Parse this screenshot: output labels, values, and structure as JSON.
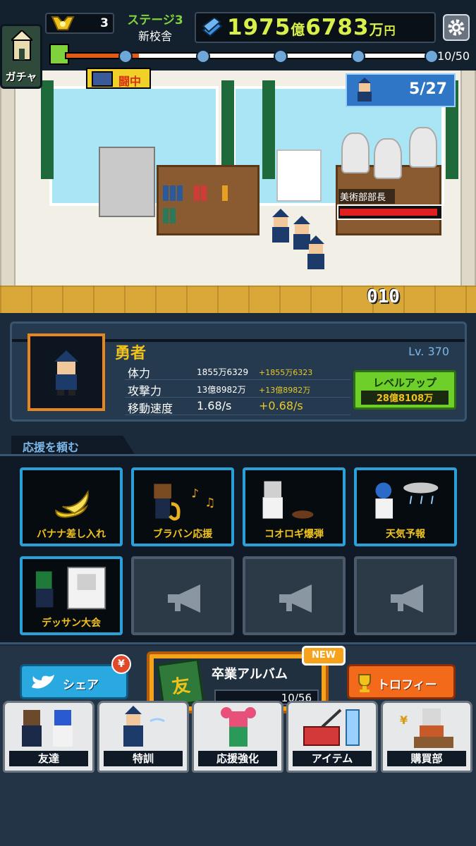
{
  "top": {
    "medal_count": "3",
    "stage_name": "ステージ3",
    "stage_place": "新校舎",
    "money_a": "1975",
    "money_unit_a": "億",
    "money_b": "6783",
    "money_unit_b": "万",
    "money_unit_c": "円",
    "progress_count": "10/50",
    "progress_fraction": 0.2,
    "gacha_label": "ガチャ",
    "fight_label": "闘中"
  },
  "battle": {
    "wave_count": "5/27",
    "boss_name": "美術部部長",
    "boss_hp_fraction": 0.97,
    "damage_number": "010"
  },
  "hero": {
    "name": "勇者",
    "level": "Lv. 370",
    "stats": [
      {
        "label": "体力",
        "value": "1855万6329",
        "bonus": "+1855万6323",
        "size": "small"
      },
      {
        "label": "攻撃力",
        "value": "13億8982万",
        "bonus": "+13億8982万",
        "size": "small"
      },
      {
        "label": "移動速度",
        "value": "1.68/s",
        "bonus": "+0.68/s",
        "size": "big"
      }
    ],
    "levelup_label": "レベルアップ",
    "levelup_cost": "28億8108万"
  },
  "support": {
    "tab_label": "応援を頼む",
    "cards": [
      {
        "name": "バナナ差し入れ",
        "icon": "banana-icon"
      },
      {
        "name": "ブラバン応援",
        "icon": "saxophone-icon"
      },
      {
        "name": "コオロギ爆弾",
        "icon": "cricket-icon"
      },
      {
        "name": "天気予報",
        "icon": "weather-icon"
      },
      {
        "name": "デッサン大会",
        "icon": "sketch-icon"
      }
    ]
  },
  "bottom": {
    "share_label": "シェア",
    "yen_badge": "¥",
    "album_title": "卒業アルバム",
    "album_count": "10/56",
    "album_book_char": "友",
    "new_badge": "NEW",
    "trophy_label": "トロフィー",
    "nav": [
      {
        "label": "友達"
      },
      {
        "label": "特訓"
      },
      {
        "label": "応援強化"
      },
      {
        "label": "アイテム"
      },
      {
        "label": "購買部"
      }
    ]
  },
  "colors": {
    "accent_green": "#7fd13d",
    "money_yellow": "#d8f04a",
    "card_border": "#2aa0d8",
    "album_orange": "#f6a21a"
  }
}
